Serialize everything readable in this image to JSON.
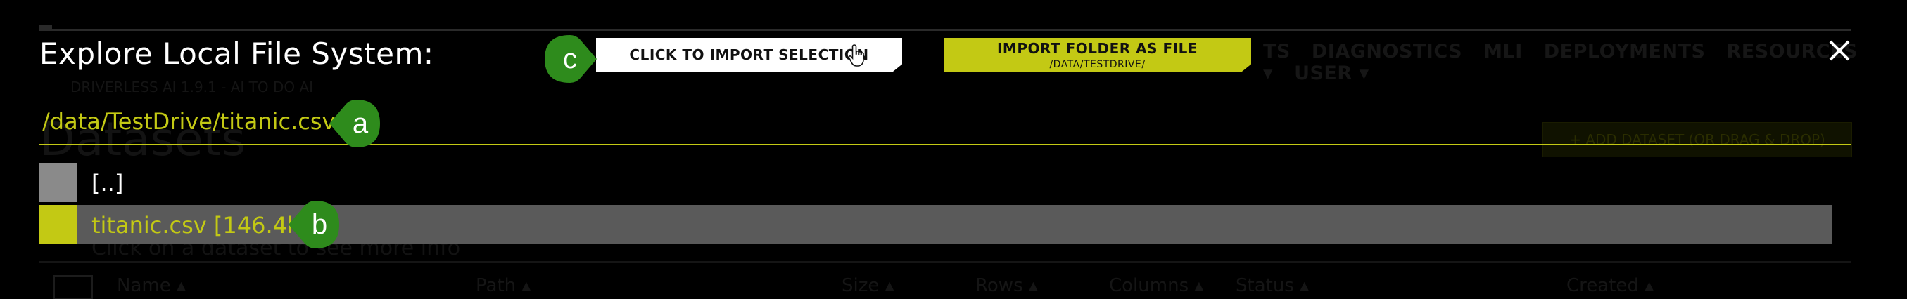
{
  "background": {
    "nav_items": [
      "TS",
      "DIAGNOSTICS",
      "MLI",
      "DEPLOYMENTS",
      "RESOURCES ▾",
      "USER ▾"
    ],
    "version_text": "DRIVERLESS AI 1.9.1 - AI TO DO AI",
    "page_title": "Datasets",
    "add_dataset_label": "+ ADD DATASET (OR DRAG & DROP)",
    "subtitle": "Click on a dataset to see more info",
    "columns": [
      "Name ▴",
      "Path ▴",
      "Size ▴",
      "Rows ▴",
      "Columns ▴",
      "Status ▴",
      "Created ▴"
    ]
  },
  "modal": {
    "title": "Explore Local File System:",
    "import_selection_label": "CLICK TO IMPORT SELECTION",
    "import_folder_label": "IMPORT FOLDER AS FILE",
    "import_folder_path": "/DATA/TESTDRIVE/",
    "current_path": "/data/TestDrive/titanic.csv",
    "entries": [
      {
        "label": "[..]",
        "type": "parent"
      },
      {
        "label": "titanic.csv [146.4kB]",
        "type": "file",
        "selected": true
      }
    ]
  },
  "callouts": {
    "a": "a",
    "b": "b",
    "c": "c"
  },
  "colors": {
    "accent": "#c3c914",
    "callout": "#2e8b1c",
    "selected_row": "#5a5a5a",
    "parent_swatch": "#8a8a8a"
  },
  "icons": {
    "close": "close-icon",
    "cursor": "hand-pointer-icon"
  }
}
